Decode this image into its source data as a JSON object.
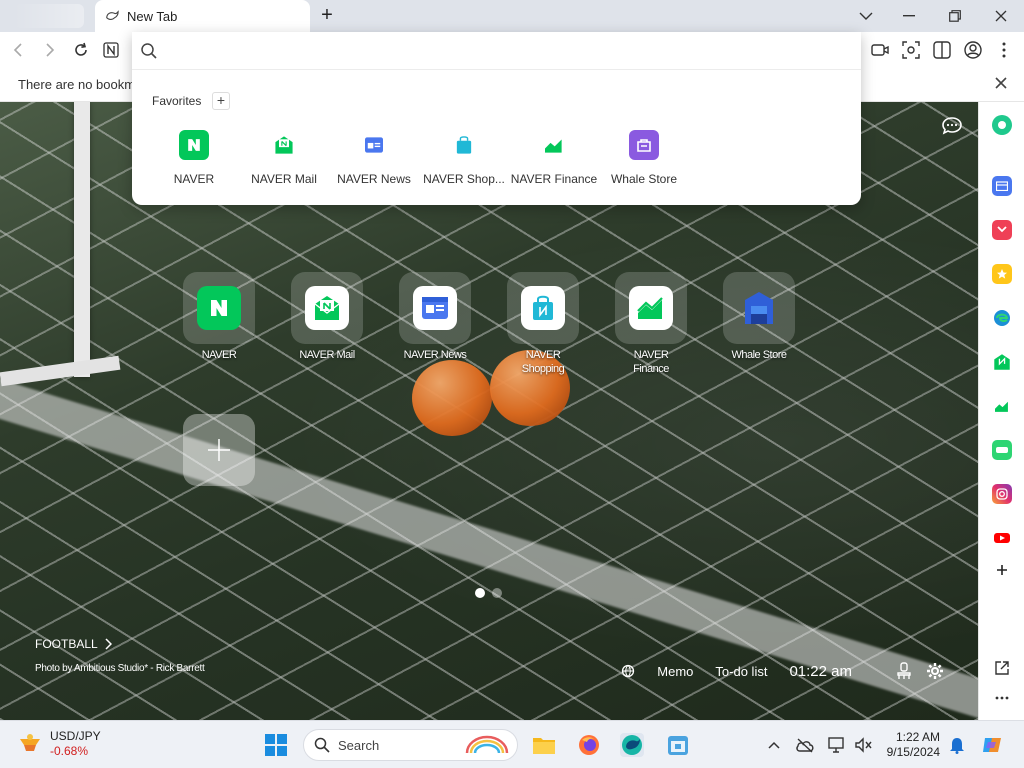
{
  "tabs": [
    {
      "title": "New Tab",
      "icon": "whale-icon"
    }
  ],
  "toolbar": {
    "icons": [
      "back-icon",
      "forward-icon",
      "reload-icon",
      "naver-icon",
      "capture-icon",
      "screenshot-icon",
      "split-view-icon",
      "profile-icon",
      "menu-icon"
    ]
  },
  "bookmarks": {
    "empty_text": "There are no bookma"
  },
  "dropdown": {
    "search_placeholder": "",
    "favorites_title": "Favorites",
    "add_label": "+",
    "items": [
      {
        "label": "NAVER",
        "color": "#03c75a"
      },
      {
        "label": "NAVER Mail",
        "color": "#03c75a"
      },
      {
        "label": "NAVER News",
        "color": "#4a77ef"
      },
      {
        "label": "NAVER Shop...",
        "color": "#20b8d6"
      },
      {
        "label": "NAVER Finance",
        "color": "#03c75a"
      },
      {
        "label": "Whale Store",
        "color": "#8a5ae0"
      }
    ]
  },
  "speed_dial": [
    {
      "label": "NAVER",
      "color": "#03c75a"
    },
    {
      "label": "NAVER Mail",
      "color": "#03c75a"
    },
    {
      "label": "NAVER News",
      "color": "#4a77ef"
    },
    {
      "label": "NAVER Shopping",
      "color": "#20b8d6"
    },
    {
      "label": "NAVER Finance",
      "color": "#03c75a"
    },
    {
      "label": "Whale Store",
      "color": "#2f5fd8"
    }
  ],
  "background": {
    "category": "FOOTBALL",
    "credit": "Photo by Ambitious Studio* - Rick Barrett"
  },
  "widgets_bar": {
    "memo": "Memo",
    "todo": "To-do list",
    "clock": "01:22 am"
  },
  "sidebar_icons": [
    "green-dot-icon",
    "calendar-icon",
    "pocket-icon",
    "star-icon",
    "edge-icon",
    "naver-mail-icon",
    "finance-icon",
    "papago-icon",
    "instagram-icon",
    "youtube-icon",
    "add-icon",
    "popout-icon",
    "more-icon"
  ],
  "taskbar": {
    "widget_title": "USD/JPY",
    "widget_change": "-0.68%",
    "search_label": "Search",
    "time": "1:22 AM",
    "date": "9/15/2024"
  },
  "colors": {
    "accent_green": "#03c75a",
    "negative": "#d12020"
  }
}
